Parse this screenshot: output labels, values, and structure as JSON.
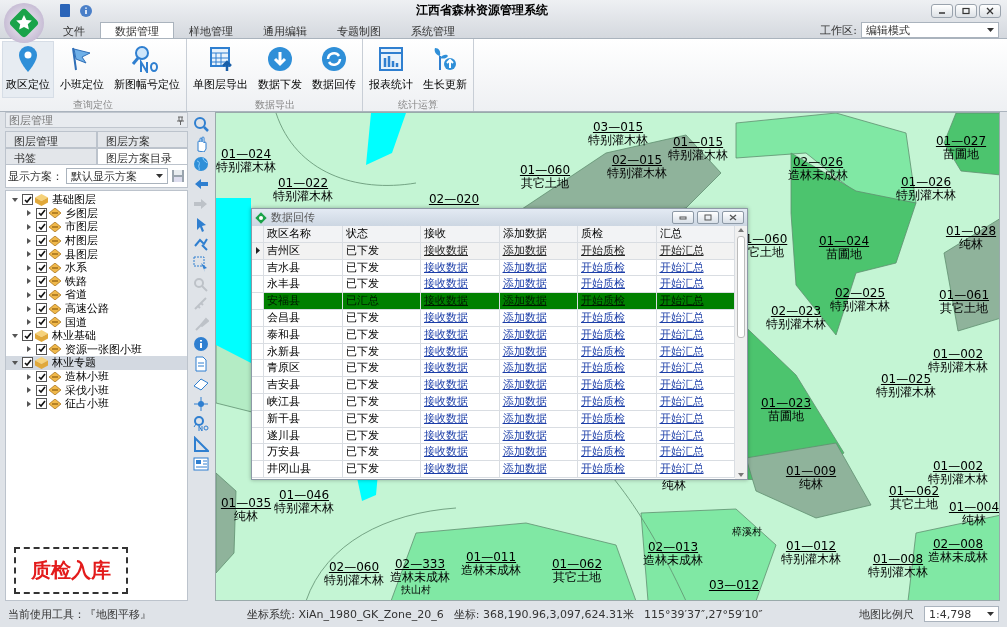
{
  "window": {
    "title": "江西省森林资源管理系统"
  },
  "ribbon": {
    "tabs": [
      {
        "label": "文件",
        "selected": false
      },
      {
        "label": "数据管理",
        "selected": true
      },
      {
        "label": "样地管理",
        "selected": false
      },
      {
        "label": "通用编辑",
        "selected": false
      },
      {
        "label": "专题制图",
        "selected": false
      },
      {
        "label": "系统管理",
        "selected": false
      }
    ],
    "workspace": {
      "label": "工作区:",
      "value": "编辑模式"
    },
    "groups": [
      {
        "label": "查询定位",
        "buttons": [
          {
            "label": "政区定位",
            "kind": "pin",
            "selected": true
          },
          {
            "label": "小班定位",
            "kind": "flag",
            "selected": false
          },
          {
            "label": "新图幅号定位",
            "kind": "number",
            "selected": false
          }
        ]
      },
      {
        "label": "数据导出",
        "buttons": [
          {
            "label": "单图层导出",
            "kind": "export",
            "selected": false
          },
          {
            "label": "数据下发",
            "kind": "download",
            "selected": false
          },
          {
            "label": "数据回传",
            "kind": "sync",
            "selected": false
          }
        ]
      },
      {
        "label": "统计运算",
        "buttons": [
          {
            "label": "报表统计",
            "kind": "report",
            "selected": false
          },
          {
            "label": "生长更新",
            "kind": "growth",
            "selected": false
          }
        ]
      }
    ]
  },
  "layer_panel": {
    "title": "图层管理",
    "tabs": [
      {
        "label": "图层管理",
        "selected": false
      },
      {
        "label": "图层方案",
        "selected": false
      },
      {
        "label": "书签",
        "selected": false
      },
      {
        "label": "图层方案目录",
        "selected": true
      }
    ],
    "scheme": {
      "label": "显示方案：",
      "value": "默认显示方案"
    },
    "tree": [
      {
        "label": "基础图层",
        "checked": true,
        "expanded": true,
        "selected": false,
        "children": [
          {
            "label": "乡图层",
            "checked": true,
            "expanded": false,
            "selected": false
          },
          {
            "label": "市图层",
            "checked": true,
            "expanded": false,
            "selected": false
          },
          {
            "label": "村图层",
            "checked": true,
            "expanded": false,
            "selected": false
          },
          {
            "label": "县图层",
            "checked": true,
            "expanded": false,
            "selected": false
          },
          {
            "label": "水系",
            "checked": true,
            "expanded": false,
            "selected": false
          },
          {
            "label": "铁路",
            "checked": true,
            "expanded": false,
            "selected": false
          },
          {
            "label": "省道",
            "checked": true,
            "expanded": false,
            "selected": false
          },
          {
            "label": "高速公路",
            "checked": true,
            "expanded": false,
            "selected": false
          },
          {
            "label": "国道",
            "checked": true,
            "expanded": false,
            "selected": false
          }
        ]
      },
      {
        "label": "林业基础",
        "checked": true,
        "expanded": true,
        "selected": false,
        "children": [
          {
            "label": "资源一张图小班",
            "checked": true,
            "expanded": false,
            "selected": false
          }
        ]
      },
      {
        "label": "林业专题",
        "checked": true,
        "expanded": true,
        "selected": true,
        "children": [
          {
            "label": "造林小班",
            "checked": true,
            "expanded": false,
            "selected": false
          },
          {
            "label": "采伐小班",
            "checked": true,
            "expanded": false,
            "selected": false
          },
          {
            "label": "征占小班",
            "checked": true,
            "expanded": false,
            "selected": false
          }
        ]
      }
    ],
    "stamp": "质检入库"
  },
  "map_tools": [
    {
      "disabled": false
    },
    {
      "disabled": false
    },
    {
      "disabled": false
    },
    {
      "disabled": false
    },
    {
      "disabled": true
    },
    {
      "disabled": false
    },
    {
      "disabled": false
    },
    {
      "disabled": false
    },
    {
      "disabled": true
    },
    {
      "disabled": true
    },
    {
      "disabled": true
    },
    {
      "disabled": false
    },
    {
      "disabled": false
    },
    {
      "disabled": false
    },
    {
      "disabled": false
    },
    {
      "disabled": false
    },
    {
      "disabled": false
    },
    {
      "disabled": false
    }
  ],
  "map": {
    "labels": [
      {
        "code": "01—024",
        "type": "特别灌木林"
      },
      {
        "code": "01—022",
        "type": "特别灌木林"
      },
      {
        "code": "02—020"
      },
      {
        "code": "03—015",
        "type": "特别灌木林"
      },
      {
        "code": "01—015",
        "type": "特别灌木林"
      },
      {
        "code": "01—060",
        "type": "其它土地"
      },
      {
        "code": "02—015",
        "type": "特别灌木林"
      },
      {
        "code": "02—026",
        "type": "造林未成林"
      },
      {
        "code": "01—027",
        "type": "苗圃地"
      },
      {
        "code": "01—026",
        "type": "特别灌木林"
      },
      {
        "code": "01—028",
        "type": "纯林"
      },
      {
        "code": "1—060",
        "type": "它土地"
      },
      {
        "code": "01—024",
        "type": "苗圃地"
      },
      {
        "code": "02—025",
        "type": "特别灌木林"
      },
      {
        "code": "02—023",
        "type": "特别灌木林"
      },
      {
        "code": "01—061",
        "type": "其它土地"
      },
      {
        "code": "01—002",
        "type": "特别灌木林"
      },
      {
        "code": "01—025",
        "type": "特别灌木林"
      },
      {
        "code": "01—023",
        "type": "苗圃地"
      },
      {
        "code": "01—009",
        "type": "纯林"
      },
      {
        "code": "01—002",
        "type": "特别灌木林"
      },
      {
        "code": "01—062",
        "type": "其它土地"
      },
      {
        "code": "01—004",
        "type": "纯林"
      },
      {
        "type": "纯林"
      },
      {
        "code": "01—035",
        "type": "纯林"
      },
      {
        "code": "01—046",
        "type": "特别灌木林"
      },
      {
        "code": "02—013",
        "type": "造林未成林"
      },
      {
        "code": "01—012",
        "type": "特别灌木林"
      },
      {
        "code": "02—008",
        "type": "造林未成林"
      },
      {
        "code": "01—008",
        "type": "特别灌木林"
      },
      {
        "code": "02—060",
        "type": "特别灌木林"
      },
      {
        "code": "02—333",
        "type": "造林未成林"
      },
      {
        "code": "01—011",
        "type": "造林未成林"
      },
      {
        "code": "01—062",
        "type": "其它土地"
      },
      {
        "code": "03—012"
      }
    ],
    "places": [
      "樟溪村",
      "扶山村"
    ]
  },
  "dialog": {
    "title": "数据回传",
    "columns": [
      "政区名称",
      "状态",
      "接收",
      "添加数据",
      "质检",
      "汇总"
    ],
    "rows": [
      {
        "cells": [
          "吉州区",
          "已下发",
          "接收数据",
          "添加数据",
          "开始质检",
          "开始汇总"
        ],
        "current": true,
        "selected": false
      },
      {
        "cells": [
          "吉水县",
          "已下发",
          "接收数据",
          "添加数据",
          "开始质检",
          "开始汇总"
        ],
        "current": false,
        "selected": false
      },
      {
        "cells": [
          "永丰县",
          "已下发",
          "接收数据",
          "添加数据",
          "开始质检",
          "开始汇总"
        ],
        "current": false,
        "selected": false
      },
      {
        "cells": [
          "安福县",
          "已汇总",
          "接收数据",
          "添加数据",
          "开始质检",
          "开始汇总"
        ],
        "current": false,
        "selected": true
      },
      {
        "cells": [
          "会昌县",
          "已下发",
          "接收数据",
          "添加数据",
          "开始质检",
          "开始汇总"
        ],
        "current": false,
        "selected": false
      },
      {
        "cells": [
          "泰和县",
          "已下发",
          "接收数据",
          "添加数据",
          "开始质检",
          "开始汇总"
        ],
        "current": false,
        "selected": false
      },
      {
        "cells": [
          "永新县",
          "已下发",
          "接收数据",
          "添加数据",
          "开始质检",
          "开始汇总"
        ],
        "current": false,
        "selected": false
      },
      {
        "cells": [
          "青原区",
          "已下发",
          "接收数据",
          "添加数据",
          "开始质检",
          "开始汇总"
        ],
        "current": false,
        "selected": false
      },
      {
        "cells": [
          "吉安县",
          "已下发",
          "接收数据",
          "添加数据",
          "开始质检",
          "开始汇总"
        ],
        "current": false,
        "selected": false
      },
      {
        "cells": [
          "峡江县",
          "已下发",
          "接收数据",
          "添加数据",
          "开始质检",
          "开始汇总"
        ],
        "current": false,
        "selected": false
      },
      {
        "cells": [
          "新干县",
          "已下发",
          "接收数据",
          "添加数据",
          "开始质检",
          "开始汇总"
        ],
        "current": false,
        "selected": false
      },
      {
        "cells": [
          "遂川县",
          "已下发",
          "接收数据",
          "添加数据",
          "开始质检",
          "开始汇总"
        ],
        "current": false,
        "selected": false
      },
      {
        "cells": [
          "万安县",
          "已下发",
          "接收数据",
          "添加数据",
          "开始质检",
          "开始汇总"
        ],
        "current": false,
        "selected": false
      },
      {
        "cells": [
          "井冈山县",
          "已下发",
          "接收数据",
          "添加数据",
          "开始质检",
          "开始汇总"
        ],
        "current": false,
        "selected": false
      }
    ]
  },
  "status_bar": {
    "tool": "当前使用工具：『地图平移』",
    "crs": "坐标系统:  XiAn_1980_GK_Zone_20_6",
    "coords": "坐标:  368,190.96,3,097,624.31米",
    "lonlat": "115°39′37″,27°59′10″",
    "scale_label": "地图比例尺",
    "scale": "1:4,798"
  }
}
